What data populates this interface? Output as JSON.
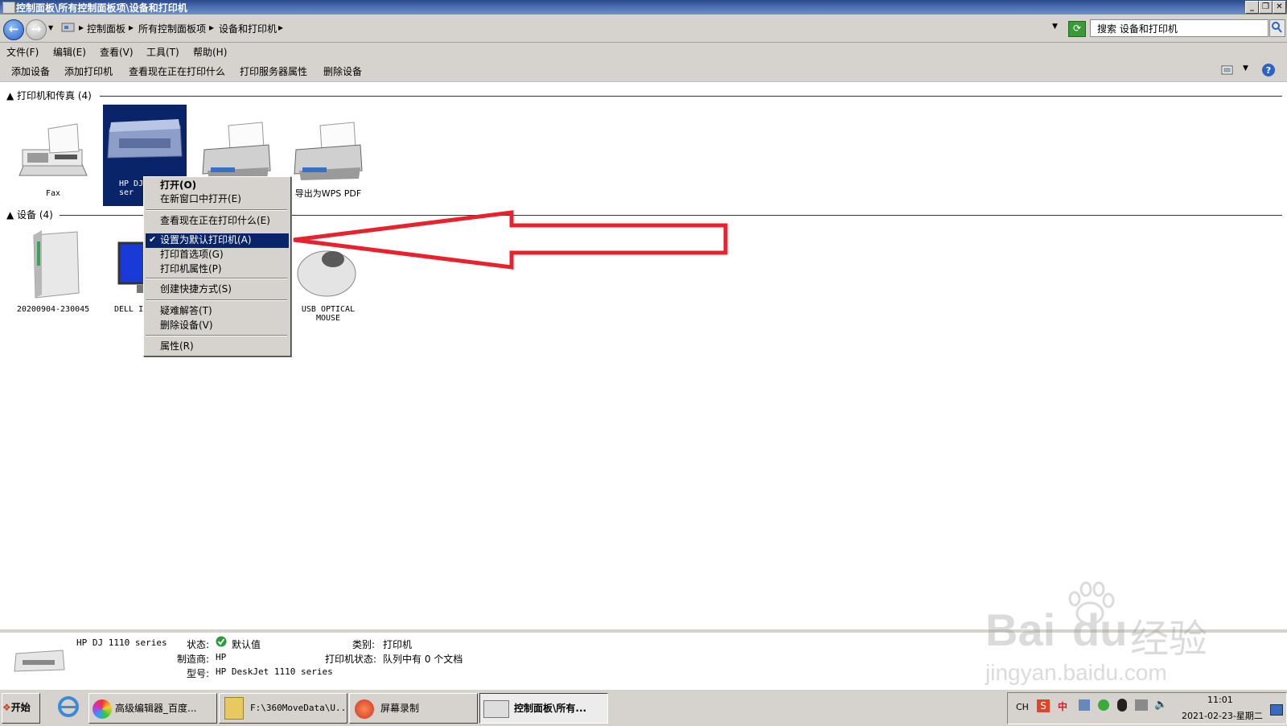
{
  "window": {
    "title": "控制面板\\所有控制面板项\\设备和打印机"
  },
  "address": {
    "crumbs": [
      "控制面板",
      "所有控制面板项",
      "设备和打印机"
    ],
    "search_placeholder": "搜索 设备和打印机"
  },
  "menu": [
    "文件(F)",
    "编辑(E)",
    "查看(V)",
    "工具(T)",
    "帮助(H)"
  ],
  "toolbar": [
    "添加设备",
    "添加打印机",
    "查看现在正在打印什么",
    "打印服务器属性",
    "删除设备"
  ],
  "groups": {
    "printers": {
      "header": "打印机和传真 (4)",
      "items": [
        {
          "label": "Fax"
        },
        {
          "label": "HP DJ\nser"
        },
        {
          "label": ""
        },
        {
          "label": "导出为WPS PDF"
        }
      ]
    },
    "devices": {
      "header": "设备 (4)",
      "items": [
        {
          "label": "20200904-230045"
        },
        {
          "label": "DELL I"
        },
        {
          "label": ""
        },
        {
          "label": "USB OPTICAL\nMOUSE"
        }
      ]
    }
  },
  "context_menu": {
    "items": [
      "打开(O)",
      "在新窗口中打开(E)",
      "查看现在正在打印什么(E)",
      "设置为默认打印机(A)",
      "打印首选项(G)",
      "打印机属性(P)",
      "创建快捷方式(S)",
      "疑难解答(T)",
      "删除设备(V)",
      "属性(R)"
    ],
    "selected_index": 3
  },
  "details": {
    "name": "HP DJ 1110 series",
    "status_label": "状态:",
    "status_value": "默认值",
    "category_label": "类别:",
    "category_value": "打印机",
    "maker_label": "制造商:",
    "maker_value": "HP",
    "printer_status_label": "打印机状态:",
    "printer_status_value": "队列中有 0 个文档",
    "model_label": "型号:",
    "model_value": "HP DeskJet 1110 series"
  },
  "taskbar": {
    "start": "开始",
    "buttons": [
      "高级编辑器_百度...",
      "F:\\360MoveData\\U...",
      "屏幕录制",
      "控制面板\\所有..."
    ],
    "lang": "CH",
    "ime": "中",
    "time": "11:01",
    "date": "2021-02-23-星期二"
  },
  "watermark": {
    "brand": "Bai",
    "brand2": "du",
    "cn": "经验",
    "url": "jingyan.baidu.com"
  },
  "colors": {
    "selection": "#0a246a",
    "annotation_arrow": "#e8212c",
    "titlebar": "#3a5a9a"
  }
}
